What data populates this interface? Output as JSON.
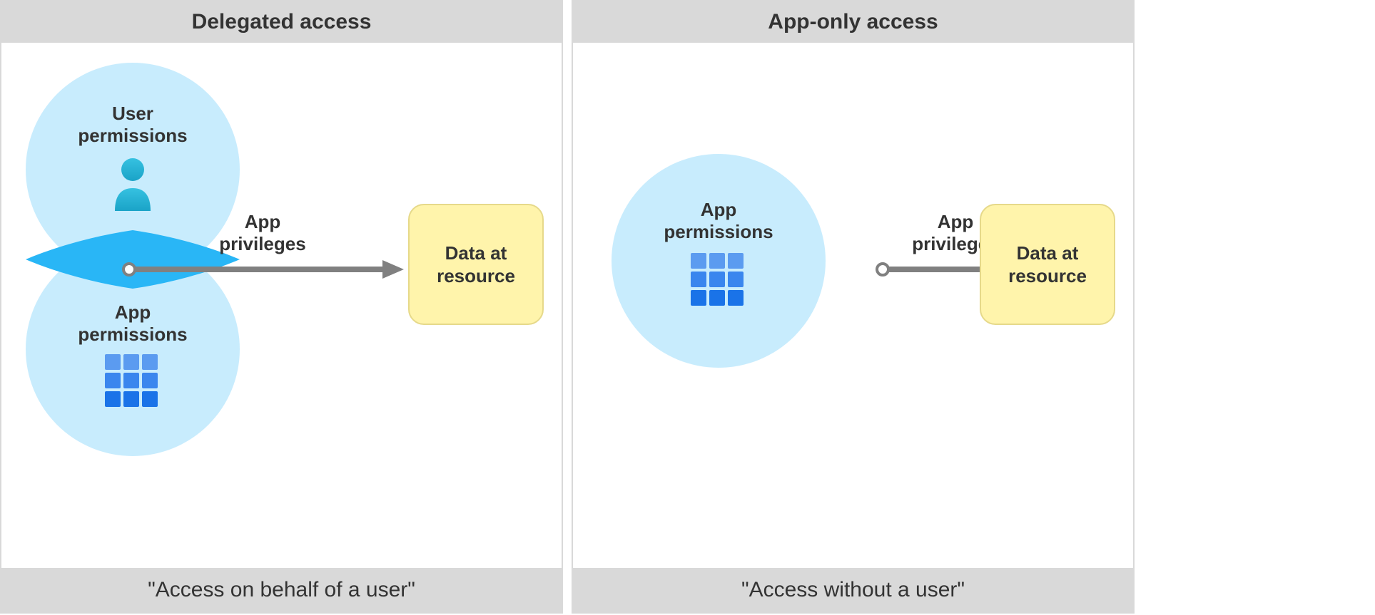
{
  "left": {
    "header": "Delegated access",
    "footer": "\"Access on behalf of a user\"",
    "user_circle_label_line1": "User",
    "user_circle_label_line2": "permissions",
    "app_circle_label_line1": "App",
    "app_circle_label_line2": "permissions",
    "arrow_label_line1": "App",
    "arrow_label_line2": "privileges",
    "data_box_line1": "Data at",
    "data_box_line2": "resource"
  },
  "right": {
    "header": "App-only access",
    "footer": "\"Access without a user\"",
    "app_circle_label_line1": "App",
    "app_circle_label_line2": "permissions",
    "arrow_label_line1": "App",
    "arrow_label_line2": "privileges",
    "data_box_line1": "Data at",
    "data_box_line2": "resource"
  },
  "colors": {
    "circle_fill": "#b3e5fc",
    "lens_fill": "#29b6f6",
    "arrow": "#808080",
    "data_box_bg": "#fff4ab",
    "data_box_border": "#e6d98a",
    "header_bg": "#d9d9d9"
  }
}
